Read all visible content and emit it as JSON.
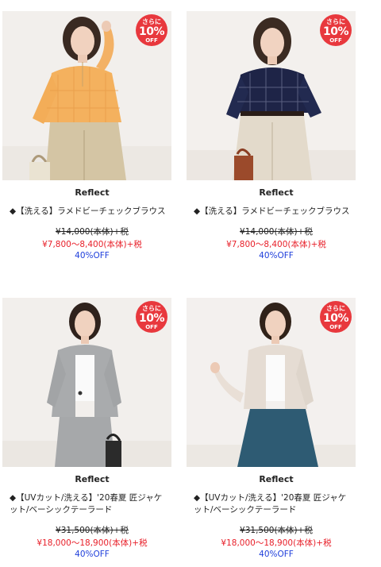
{
  "colors": {
    "sale": "#e8202a",
    "discount": "#1f3fdb",
    "badge": "#e8383d"
  },
  "products": [
    {
      "brand": "Reflect",
      "name_lines": [
        "◆【洗える】ラメドビーチェックブラウス"
      ],
      "original_price": "¥14,000(本体)+税",
      "sale_price": "¥7,800〜8,400(本体)+税",
      "discount": "40%OFF",
      "badge": {
        "line1": "さらに",
        "line2": "10%",
        "line3": "OFF"
      },
      "image": "woman-orange-check-blouse"
    },
    {
      "brand": "Reflect",
      "name_lines": [
        "◆【洗える】ラメドビーチェックブラウス"
      ],
      "original_price": "¥14,000(本体)+税",
      "sale_price": "¥7,800〜8,400(本体)+税",
      "discount": "40%OFF",
      "badge": {
        "line1": "さらに",
        "line2": "10%",
        "line3": "OFF"
      },
      "image": "woman-navy-check-blouse"
    },
    {
      "brand": "Reflect",
      "name_lines": [
        "◆【UVカット/洗える】'20春夏 匠ジャケ",
        "ット/ベーシックテーラード"
      ],
      "original_price": "¥31,500(本体)+税",
      "sale_price": "¥18,000〜18,900(本体)+税",
      "discount": "40%OFF",
      "badge": {
        "line1": "さらに",
        "line2": "10%",
        "line3": "OFF"
      },
      "image": "woman-grey-jacket"
    },
    {
      "brand": "Reflect",
      "name_lines": [
        "◆【UVカット/洗える】'20春夏 匠ジャケ",
        "ット/ベーシックテーラード"
      ],
      "original_price": "¥31,500(本体)+税",
      "sale_price": "¥18,000〜18,900(本体)+税",
      "discount": "40%OFF",
      "badge": {
        "line1": "さらに",
        "line2": "10%",
        "line3": "OFF"
      },
      "image": "woman-beige-jacket"
    }
  ]
}
